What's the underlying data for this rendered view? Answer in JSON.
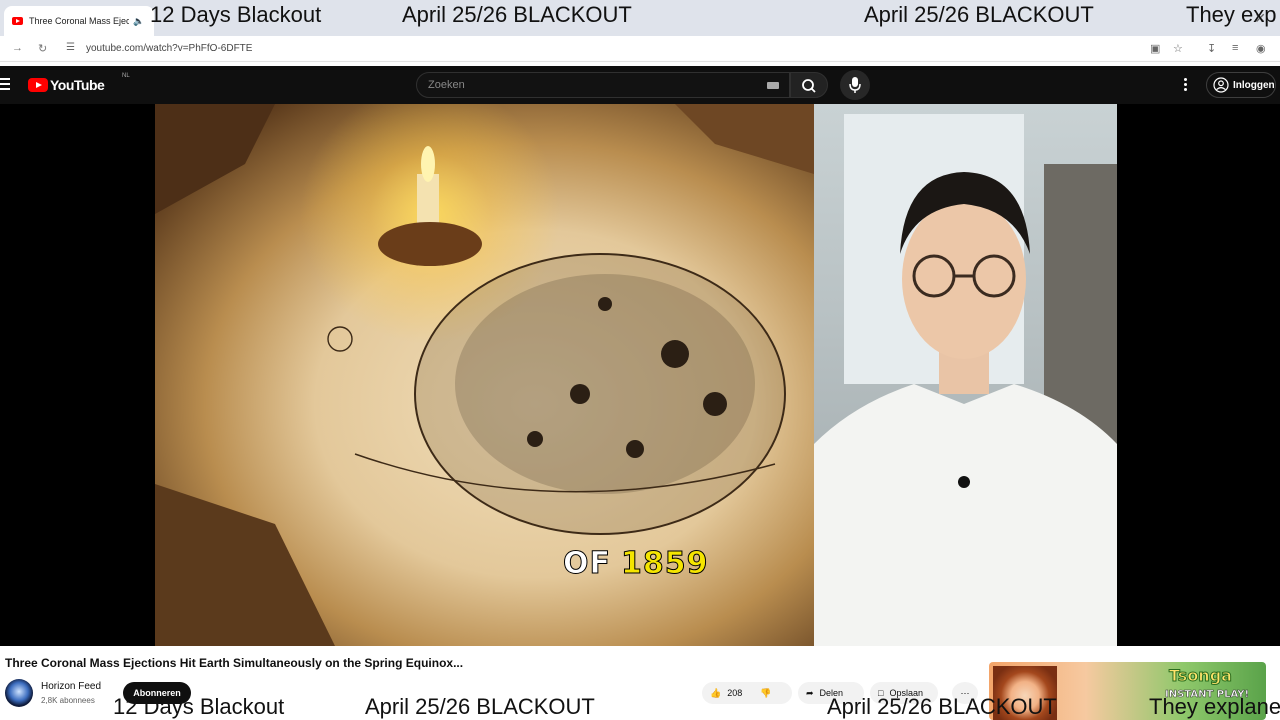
{
  "browser": {
    "tab_title": "Three Coronal Mass Ejectio",
    "url": "youtube.com/watch?v=PhFfO-6DFTE"
  },
  "ticker_top": {
    "items": [
      "12 Days Blackout",
      "April 25/26 BLACKOUT",
      "April 25/26 BLACKOUT",
      "They exp"
    ]
  },
  "youtube": {
    "logo_text": "YouTube",
    "region": "NL",
    "search_placeholder": "Zoeken",
    "signin_label": "Inloggen"
  },
  "video": {
    "caption_a": "OF",
    "caption_b": "1859",
    "title": "Three Coronal Mass Ejections Hit Earth Simultaneously on the Spring Equinox..."
  },
  "channel": {
    "name": "Horizon Feed",
    "subscribers": "2,8K abonnees",
    "subscribe_label": "Abonneren"
  },
  "actions": {
    "likes": "208",
    "share_label": "Delen",
    "save_label": "Opslaan"
  },
  "ad": {
    "brand": "Tsonga",
    "cta": "INSTANT PLAY!"
  },
  "ticker_bottom": {
    "items": [
      "12 Days Blackout",
      "April 25/26 BLACKOUT",
      "April 25/26 BLACKOUT",
      "They explane"
    ]
  }
}
